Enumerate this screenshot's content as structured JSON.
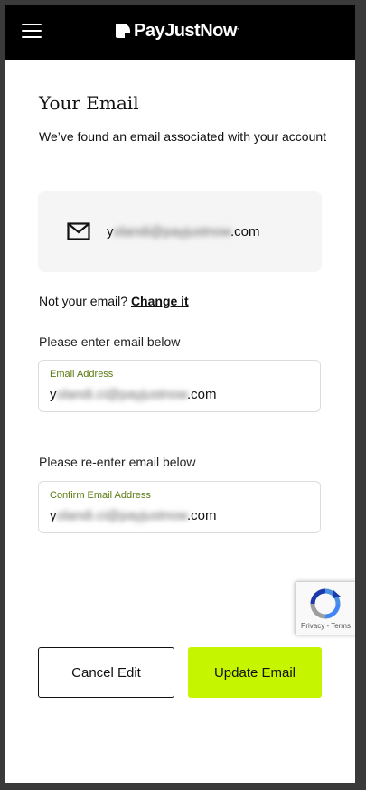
{
  "header": {
    "logo_text": "PayJustNow",
    "logo_mark": "."
  },
  "main": {
    "title": "Your Email",
    "subtitle": "We’ve found an email associated with your account",
    "current_email": {
      "prefix": "y",
      "blurred": "olandi@payjustnow",
      "suffix": ".com",
      "icon": "mail-icon"
    },
    "not_email_text": "Not your email?",
    "change_link": "Change it"
  },
  "form": {
    "email_prompt": "Please enter email below",
    "email_label": "Email Address",
    "email_value": {
      "prefix": "y",
      "blurred": "olandi.ci@payjustnow",
      "suffix": ".com"
    },
    "confirm_prompt": "Please re-enter email below",
    "confirm_label": "Confirm Email Address",
    "confirm_value": {
      "prefix": "y",
      "blurred": "olandi.ci@payjustnow",
      "suffix": ".com"
    }
  },
  "recaptcha": {
    "text": "Privacy - Terms"
  },
  "buttons": {
    "cancel": "Cancel Edit",
    "update": "Update Email"
  },
  "colors": {
    "accent": "#c6f500",
    "header_bg": "#000000",
    "card_bg": "#f4f5f4",
    "label_green": "#5a7a12"
  }
}
